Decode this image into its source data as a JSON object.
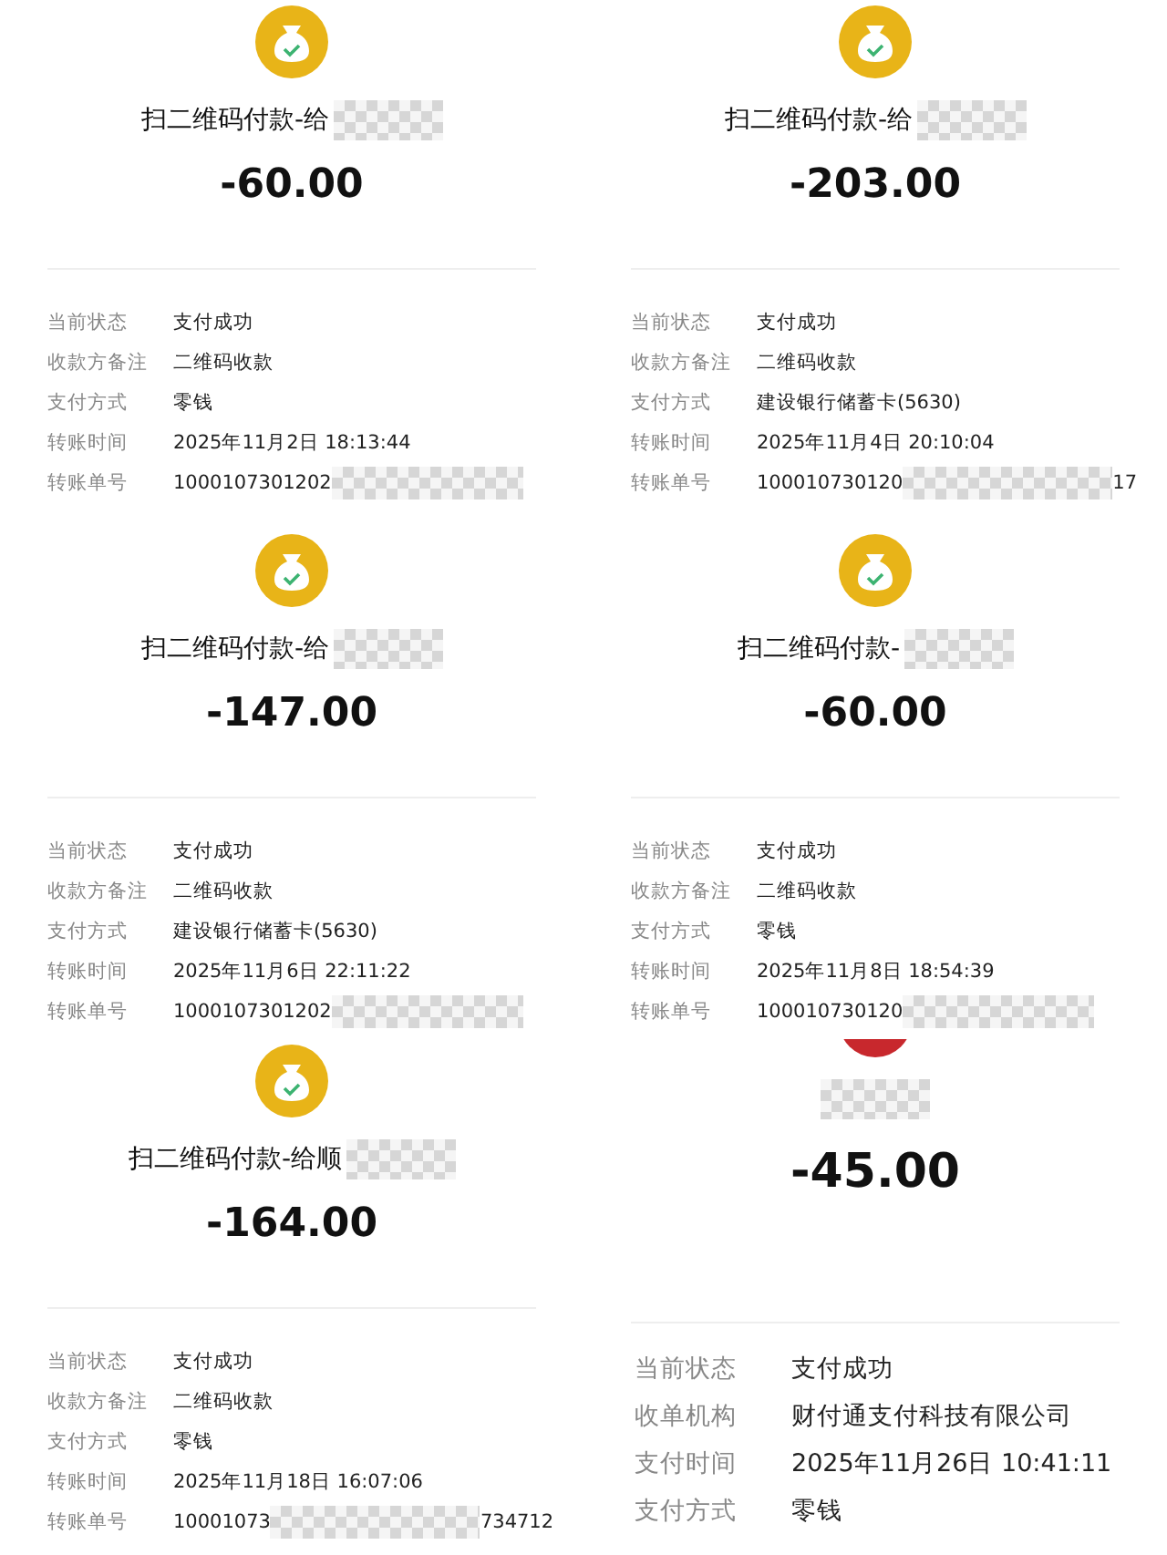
{
  "receipts": [
    {
      "kind": "coin",
      "title": "扫二维码付款-给",
      "title_masked": true,
      "amount": "-60.00",
      "rows": [
        {
          "label": "当前状态",
          "value": "支付成功"
        },
        {
          "label": "收款方备注",
          "value": "二维码收款"
        },
        {
          "label": "支付方式",
          "value": "零钱"
        },
        {
          "label": "转账时间",
          "value": "2025年11月2日 18:13:44"
        },
        {
          "label": "转账单号",
          "value": "1000107301202",
          "masked": true
        }
      ]
    },
    {
      "kind": "coin",
      "title": "扫二维码付款-给",
      "title_masked": true,
      "amount": "-203.00",
      "rows": [
        {
          "label": "当前状态",
          "value": "支付成功"
        },
        {
          "label": "收款方备注",
          "value": "二维码收款"
        },
        {
          "label": "支付方式",
          "value": "建设银行储蓄卡(5630)"
        },
        {
          "label": "转账时间",
          "value": "2025年11月4日 20:10:04"
        },
        {
          "label": "转账单号",
          "value": "100010730120",
          "masked": true,
          "tail": "17"
        }
      ]
    },
    {
      "kind": "coin",
      "title": "扫二维码付款-给",
      "title_masked": true,
      "amount": "-147.00",
      "rows": [
        {
          "label": "当前状态",
          "value": "支付成功"
        },
        {
          "label": "收款方备注",
          "value": "二维码收款"
        },
        {
          "label": "支付方式",
          "value": "建设银行储蓄卡(5630)"
        },
        {
          "label": "转账时间",
          "value": "2025年11月6日 22:11:22"
        },
        {
          "label": "转账单号",
          "value": "1000107301202",
          "masked": true
        }
      ]
    },
    {
      "kind": "coin",
      "title": "扫二维码付款-",
      "title_masked": true,
      "amount": "-60.00",
      "rows": [
        {
          "label": "当前状态",
          "value": "支付成功"
        },
        {
          "label": "收款方备注",
          "value": "二维码收款"
        },
        {
          "label": "支付方式",
          "value": "零钱"
        },
        {
          "label": "转账时间",
          "value": "2025年11月8日 18:54:39"
        },
        {
          "label": "转账单号",
          "value": "100010730120",
          "masked": true
        }
      ]
    },
    {
      "kind": "coin",
      "title": "扫二维码付款-给顺",
      "title_masked": true,
      "amount": "-164.00",
      "rows": [
        {
          "label": "当前状态",
          "value": "支付成功"
        },
        {
          "label": "收款方备注",
          "value": "二维码收款"
        },
        {
          "label": "支付方式",
          "value": "零钱"
        },
        {
          "label": "转账时间",
          "value": "2025年11月18日 16:07:06"
        },
        {
          "label": "转账单号",
          "value": "10001073",
          "masked": true,
          "tail": "734712"
        }
      ]
    },
    {
      "kind": "merchant",
      "title_masked": true,
      "amount": "-45.00",
      "rows": [
        {
          "label": "当前状态",
          "value": "支付成功"
        },
        {
          "label": "收单机构",
          "value": "财付通支付科技有限公司"
        },
        {
          "label": "支付时间",
          "value": "2025年11月26日 10:41:11"
        },
        {
          "label": "支付方式",
          "value": "零钱"
        }
      ]
    }
  ]
}
